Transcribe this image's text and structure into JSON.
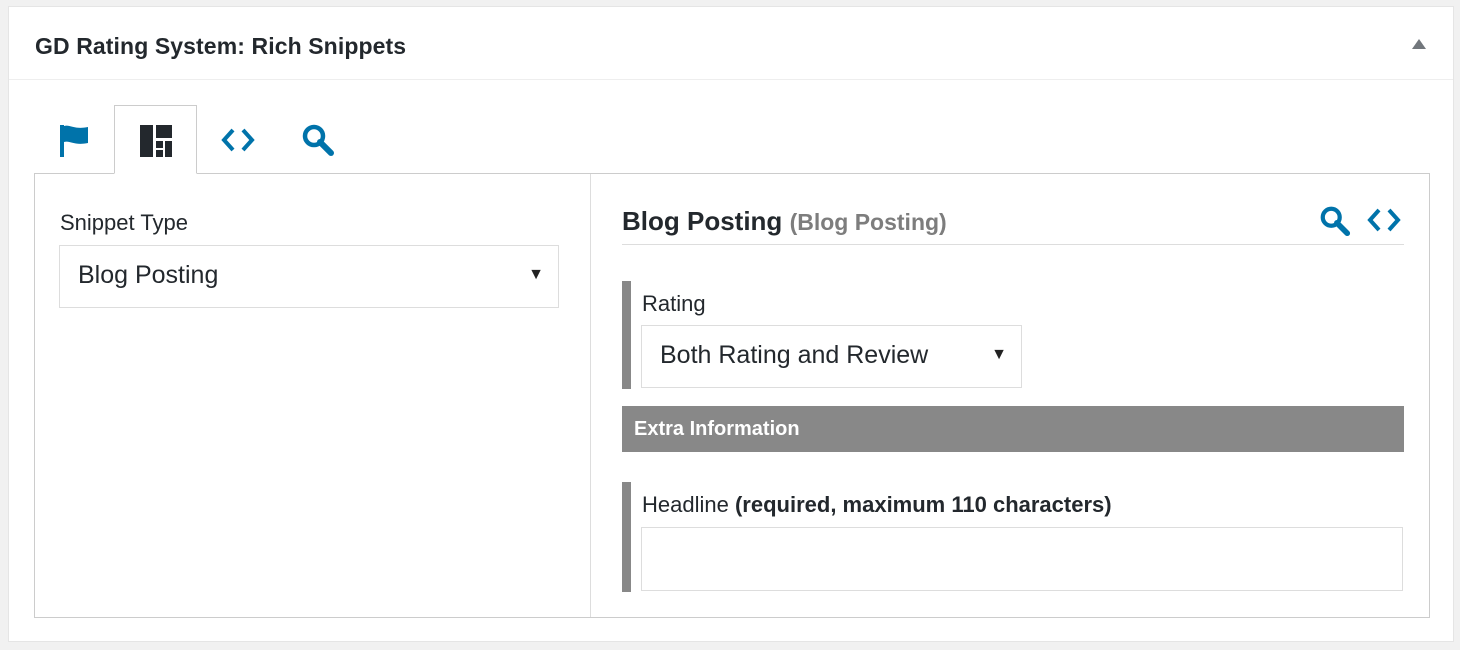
{
  "postbox": {
    "title": "GD Rating System: Rich Snippets"
  },
  "tabs": [
    {
      "icon": "flag-icon",
      "active": false
    },
    {
      "icon": "layout-grid-icon",
      "active": true
    },
    {
      "icon": "code-icon",
      "active": false
    },
    {
      "icon": "search-icon",
      "active": false
    }
  ],
  "left": {
    "snippet_type_label": "Snippet Type",
    "snippet_type_value": "Blog Posting"
  },
  "right": {
    "title": "Blog Posting",
    "subtitle": "(Blog Posting)",
    "rating_label": "Rating",
    "rating_value": "Both Rating and Review",
    "section_title": "Extra Information",
    "headline_label": "Headline",
    "headline_note": "(required, maximum 110 characters)",
    "headline_value": ""
  },
  "colors": {
    "accent": "#0073aa",
    "section_bar": "#888888",
    "text": "#23282d"
  }
}
